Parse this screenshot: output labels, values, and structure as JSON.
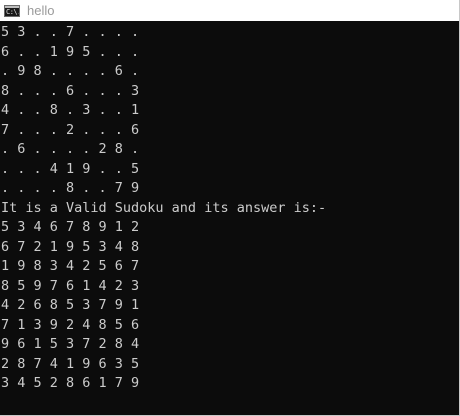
{
  "window": {
    "title": "hello",
    "icon_name": "console-app-icon",
    "icon_glyph": "C:\\."
  },
  "console": {
    "lines": [
      "5 3 . . 7 . . . .",
      "6 . . 1 9 5 . . .",
      ". 9 8 . . . . 6 .",
      "8 . . . 6 . . . 3",
      "4 . . 8 . 3 . . 1",
      "7 . . . 2 . . . 6",
      ". 6 . . . . 2 8 .",
      ". . . 4 1 9 . . 5",
      ". . . . 8 . . 7 9",
      "It is a Valid Sudoku and its answer is:-",
      "5 3 4 6 7 8 9 1 2",
      "6 7 2 1 9 5 3 4 8",
      "1 9 8 3 4 2 5 6 7",
      "8 5 9 7 6 1 4 2 3",
      "4 2 6 8 5 3 7 9 1",
      "7 1 3 9 2 4 8 5 6",
      "9 6 1 5 3 7 2 8 4",
      "2 8 7 4 1 9 6 3 5",
      "3 4 5 2 8 6 1 7 9"
    ]
  },
  "colors": {
    "console_background": "#0c0c0c",
    "console_text": "#cccccc",
    "titlebar_background": "#ffffff",
    "title_text": "#9a9a9a"
  }
}
